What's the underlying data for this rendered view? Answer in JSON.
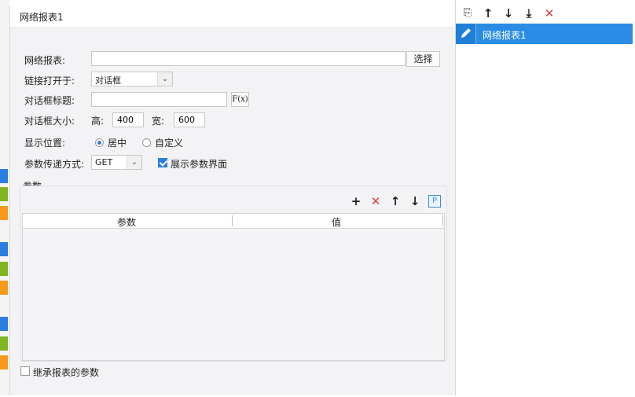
{
  "dialog": {
    "title": "网络报表1",
    "fields": {
      "report_label": "网络报表:",
      "report_value": "",
      "choose_button": "选择",
      "open_in_label": "链接打开于:",
      "open_in_value": "对话框",
      "dialog_title_label": "对话框标题:",
      "dialog_title_value": "",
      "formula_button": "F(x)",
      "dialog_size_label": "对话框大小:",
      "height_label": "高:",
      "height_value": "400",
      "width_label": "宽:",
      "width_value": "600",
      "position_label": "显示位置:",
      "position_options": [
        "居中",
        "自定义"
      ],
      "position_selected": "居中",
      "param_method_label": "参数传递方式:",
      "param_method_value": "GET",
      "show_param_ui_label": "展示参数界面",
      "show_param_ui_checked": true
    },
    "params": {
      "group_title": "参数",
      "columns": [
        "参数",
        "值"
      ],
      "rows": []
    },
    "inherit_label": "继承报表的参数",
    "inherit_checked": false
  },
  "right_panel": {
    "items": [
      {
        "label": "网络报表1",
        "selected": true
      }
    ]
  },
  "background": {
    "axis_ticks": [
      "20",
      "30",
      "40",
      "50",
      "60"
    ],
    "strip_colors": [
      "#2a7de1",
      "#7fb520",
      "#f59a1b"
    ]
  },
  "colors": {
    "accent": "#2a8ce4",
    "delete": "#e04040",
    "dialog_bg": "#f3f3f5"
  }
}
